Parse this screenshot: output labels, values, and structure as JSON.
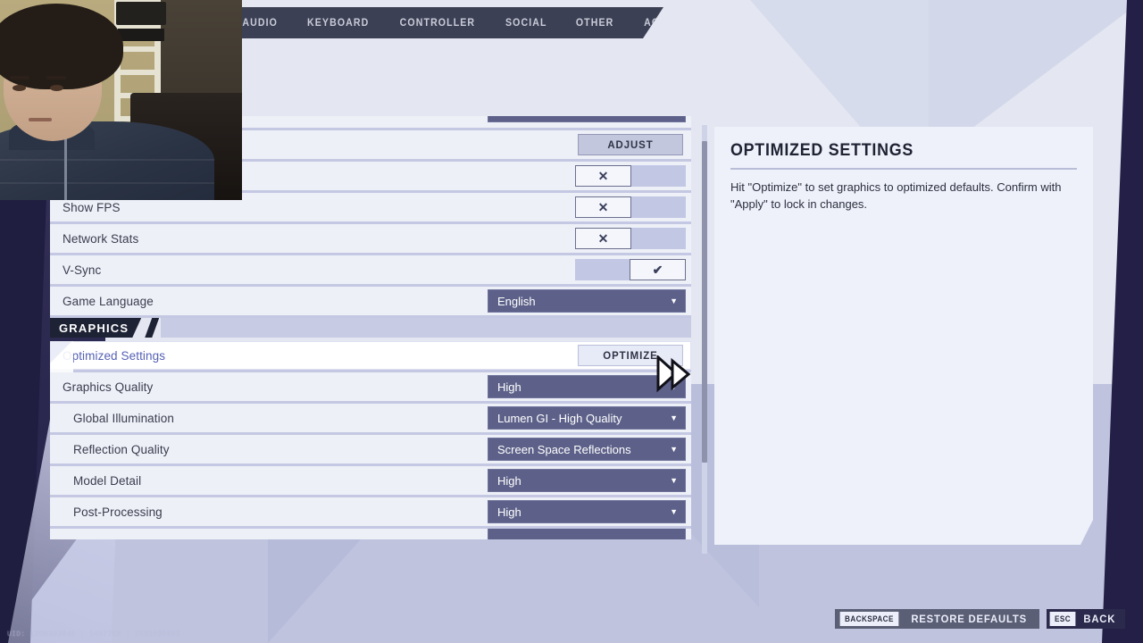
{
  "tabs": [
    {
      "label": "AUDIO"
    },
    {
      "label": "KEYBOARD"
    },
    {
      "label": "CONTROLLER"
    },
    {
      "label": "SOCIAL"
    },
    {
      "label": "OTHER"
    },
    {
      "label": "ACCESSIBILITY"
    }
  ],
  "settings_rows": [
    {
      "label": "",
      "control": "dropdown",
      "value": "",
      "clipped": true
    },
    {
      "label": "",
      "control": "button",
      "value": "ADJUST"
    },
    {
      "label": "",
      "control": "toggle",
      "value": "off",
      "off_glyph": "✕",
      "on_glyph": "✔"
    },
    {
      "label": "Show FPS",
      "control": "toggle",
      "value": "off",
      "off_glyph": "✕",
      "on_glyph": "✔"
    },
    {
      "label": "Network Stats",
      "control": "toggle",
      "value": "off",
      "off_glyph": "✕",
      "on_glyph": "✔"
    },
    {
      "label": "V-Sync",
      "control": "toggle",
      "value": "on",
      "off_glyph": "✕",
      "on_glyph": "✔"
    },
    {
      "label": "Game Language",
      "control": "dropdown",
      "value": "English"
    }
  ],
  "graphics_section": {
    "title": "GRAPHICS",
    "rows": [
      {
        "label": "Optimized Settings",
        "control": "button",
        "value": "OPTIMIZE",
        "selected": true,
        "indent": false
      },
      {
        "label": "Graphics Quality",
        "control": "dropdown",
        "value": "High",
        "indent": false
      },
      {
        "label": "Global Illumination",
        "control": "dropdown",
        "value": "Lumen GI - High Quality",
        "indent": true
      },
      {
        "label": "Reflection Quality",
        "control": "dropdown",
        "value": "Screen Space Reflections",
        "indent": true
      },
      {
        "label": "Model Detail",
        "control": "dropdown",
        "value": "High",
        "indent": true
      },
      {
        "label": "Post-Processing",
        "control": "dropdown",
        "value": "High",
        "indent": true
      }
    ]
  },
  "info_panel": {
    "title": "OPTIMIZED SETTINGS",
    "body": "Hit \"Optimize\" to set graphics to optimized defaults. Confirm with \"Apply\" to lock in changes."
  },
  "footer": {
    "prompts": [
      {
        "key": "BACKSPACE",
        "action": "RESTORE DEFAULTS"
      },
      {
        "key": "ESC",
        "action": "BACK"
      }
    ]
  },
  "debug_overlay": {
    "text": "UID: 1200393949 | 1457768 | 7501800983"
  },
  "caret_glyph": "▼",
  "colors": {
    "row_bg": "#eef0f8",
    "row_selected_bg": "#ffffff",
    "row_selected_text": "#5561b5",
    "dropdown_bg": "#5d6189",
    "toggle_off_fill": "#c2c7e4",
    "section_chip_bg": "#1e2235",
    "tabbar_bg": "#3c4054",
    "panel_bg": "#eef1f9",
    "background": "#dfe3ef",
    "left_panel_dark": "#23214a"
  }
}
